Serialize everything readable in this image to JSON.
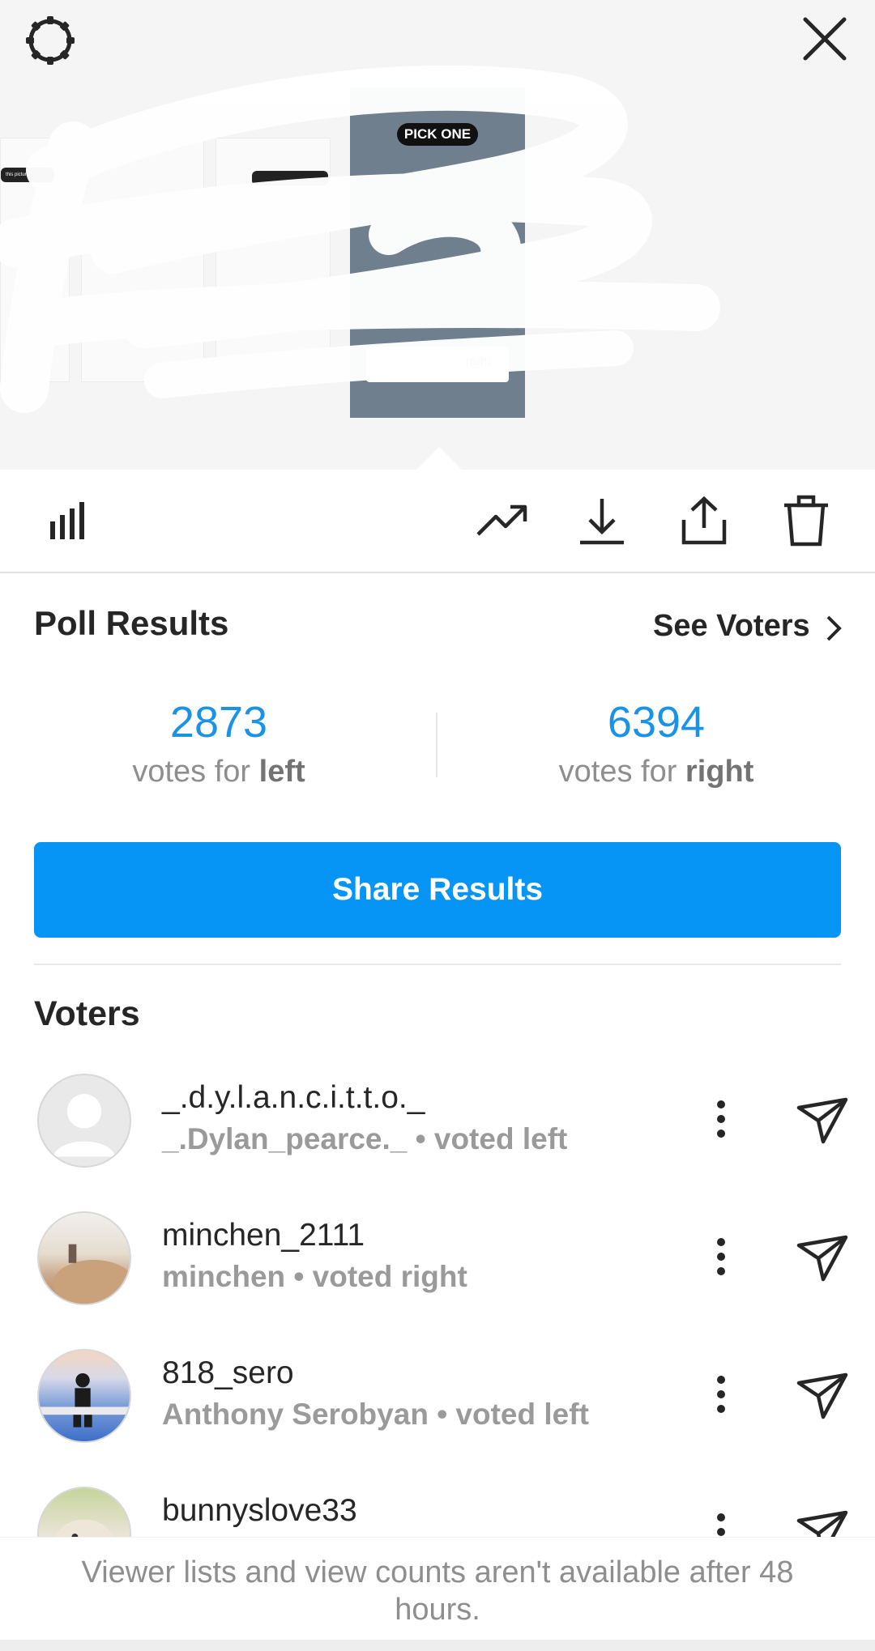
{
  "story_preview": {
    "sticker_label": "PICK ONE",
    "poll_option_right": "right",
    "thumb_sticker_text": "this picture"
  },
  "poll": {
    "title": "Poll Results",
    "see_voters_label": "See Voters",
    "left": {
      "count": "2873",
      "prefix": "votes for ",
      "option": "left"
    },
    "right": {
      "count": "6394",
      "prefix": "votes for ",
      "option": "right"
    },
    "share_label": "Share Results"
  },
  "voters": {
    "title": "Voters",
    "items": [
      {
        "username": "_.d.y.l.a.n.c.i.t.t.o._",
        "subtitle": "_.Dylan_pearce._ • voted left",
        "avatar": "default-avatar"
      },
      {
        "username": "minchen_2111",
        "subtitle": "minchen • voted right",
        "avatar": "photo-avatar-field"
      },
      {
        "username": "818_sero",
        "subtitle": "Anthony Serobyan • voted left",
        "avatar": "photo-avatar-sky"
      },
      {
        "username": "bunnyslove33",
        "subtitle": "",
        "avatar": "photo-avatar-bunny"
      }
    ]
  },
  "footer": {
    "text": "Viewer lists and view counts aren't available after 48 hours."
  },
  "colors": {
    "accent": "#0795f5",
    "vote_number": "#1a93e6",
    "muted_text": "#8e8e8e"
  },
  "icons": [
    "settings-icon",
    "close-icon",
    "bar-chart-icon",
    "trending-icon",
    "download-icon",
    "share-icon",
    "trash-icon",
    "chevron-right-icon",
    "more-icon",
    "send-icon"
  ]
}
